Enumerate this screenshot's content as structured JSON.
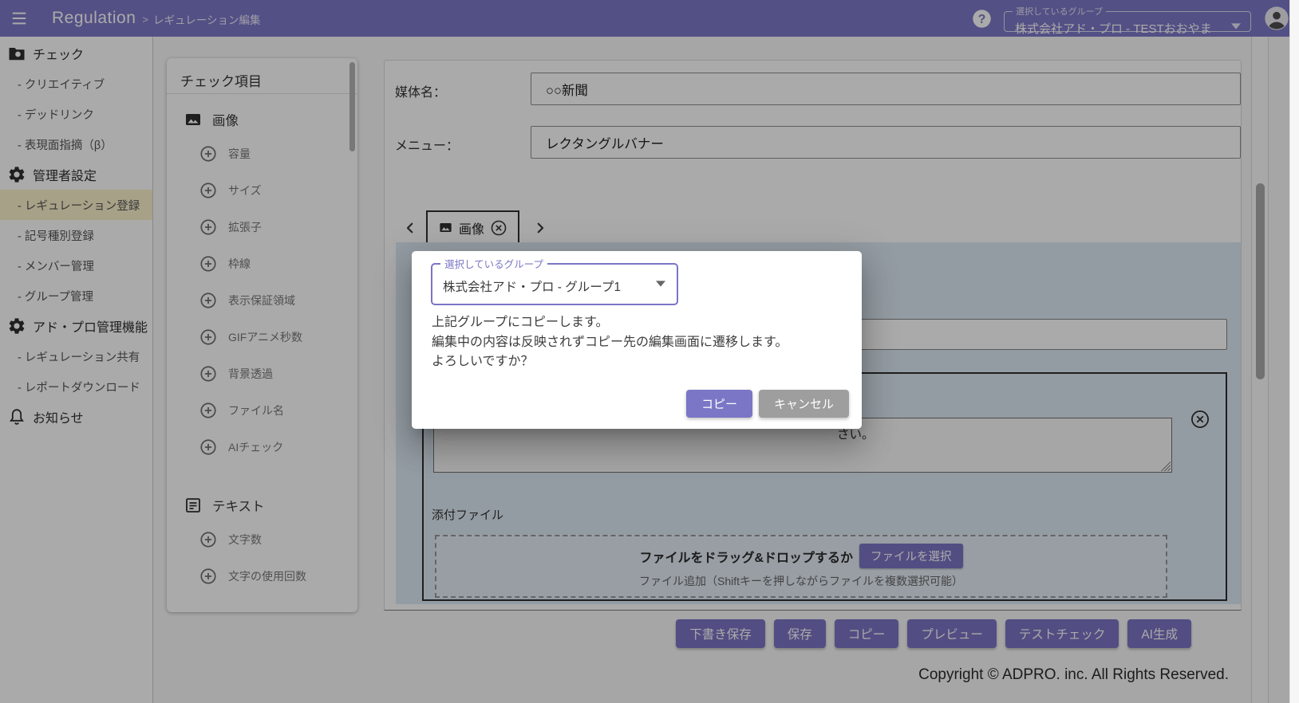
{
  "colors": {
    "accent_purple": "#7b76c5",
    "header_bg": "#7d78c8",
    "active_item_bg": "#fbf2cb",
    "tab_panel_bg": "#dfeaf5",
    "cancel_gray": "#9e9e9e"
  },
  "header": {
    "app_title": "Regulation",
    "breadcrumb_separator": ">",
    "breadcrumb": "レギュレーション編集",
    "group_select": {
      "label": "選択しているグループ",
      "value": "株式会社アド・プロ - TESTおおやま"
    }
  },
  "sidebar": {
    "sections": [
      {
        "label": "チェック",
        "items": [
          {
            "label": "- クリエイティブ"
          },
          {
            "label": "- デッドリンク"
          },
          {
            "label": "- 表現面指摘（β）"
          }
        ]
      },
      {
        "label": "管理者設定",
        "items": [
          {
            "label": "- レギュレーション登録"
          },
          {
            "label": "- 記号種別登録"
          },
          {
            "label": "- メンバー管理"
          },
          {
            "label": "- グループ管理"
          }
        ]
      },
      {
        "label": "アド・プロ管理機能",
        "items": [
          {
            "label": "- レギュレーション共有"
          },
          {
            "label": "- レポートダウンロード"
          }
        ]
      },
      {
        "label": "お知らせ",
        "items": []
      }
    ]
  },
  "check_items_panel": {
    "title": "チェック項目",
    "groups": [
      {
        "label": "画像",
        "items": [
          "容量",
          "サイズ",
          "拡張子",
          "枠線",
          "表示保証領域",
          "GIFアニメ秒数",
          "背景透過",
          "ファイル名",
          "AIチェック"
        ]
      },
      {
        "label": "テキスト",
        "items": [
          "文字数",
          "文字の使用回数"
        ]
      }
    ]
  },
  "main": {
    "fields": [
      {
        "label": "媒体名：",
        "value": "○○新聞"
      },
      {
        "label": "メニュー：",
        "value": "レクタングルバナー"
      }
    ],
    "tab": {
      "label": "画像"
    },
    "panel": {
      "textarea_visible_text": "さい。",
      "attachment_label": "添付ファイル",
      "dropzone_text": "ファイルをドラッグ&ドロップするか",
      "file_select_button": "ファイルを選択",
      "dropzone_subtext": "ファイル追加（Shiftキーを押しながらファイルを複数選択可能）"
    },
    "action_buttons": [
      "下書き保存",
      "保存",
      "コピー",
      "プレビュー",
      "テストチェック",
      "AI生成"
    ],
    "copyright": "Copyright © ADPRO. inc. All Rights Reserved."
  },
  "modal": {
    "group_select": {
      "label": "選択しているグループ",
      "value": "株式会社アド・プロ - グループ1"
    },
    "message_lines": [
      "上記グループにコピーします。",
      "編集中の内容は反映されずコピー先の編集画面に遷移します。",
      "よろしいですか？"
    ],
    "confirm_button": "コピー",
    "cancel_button": "キャンセル"
  }
}
